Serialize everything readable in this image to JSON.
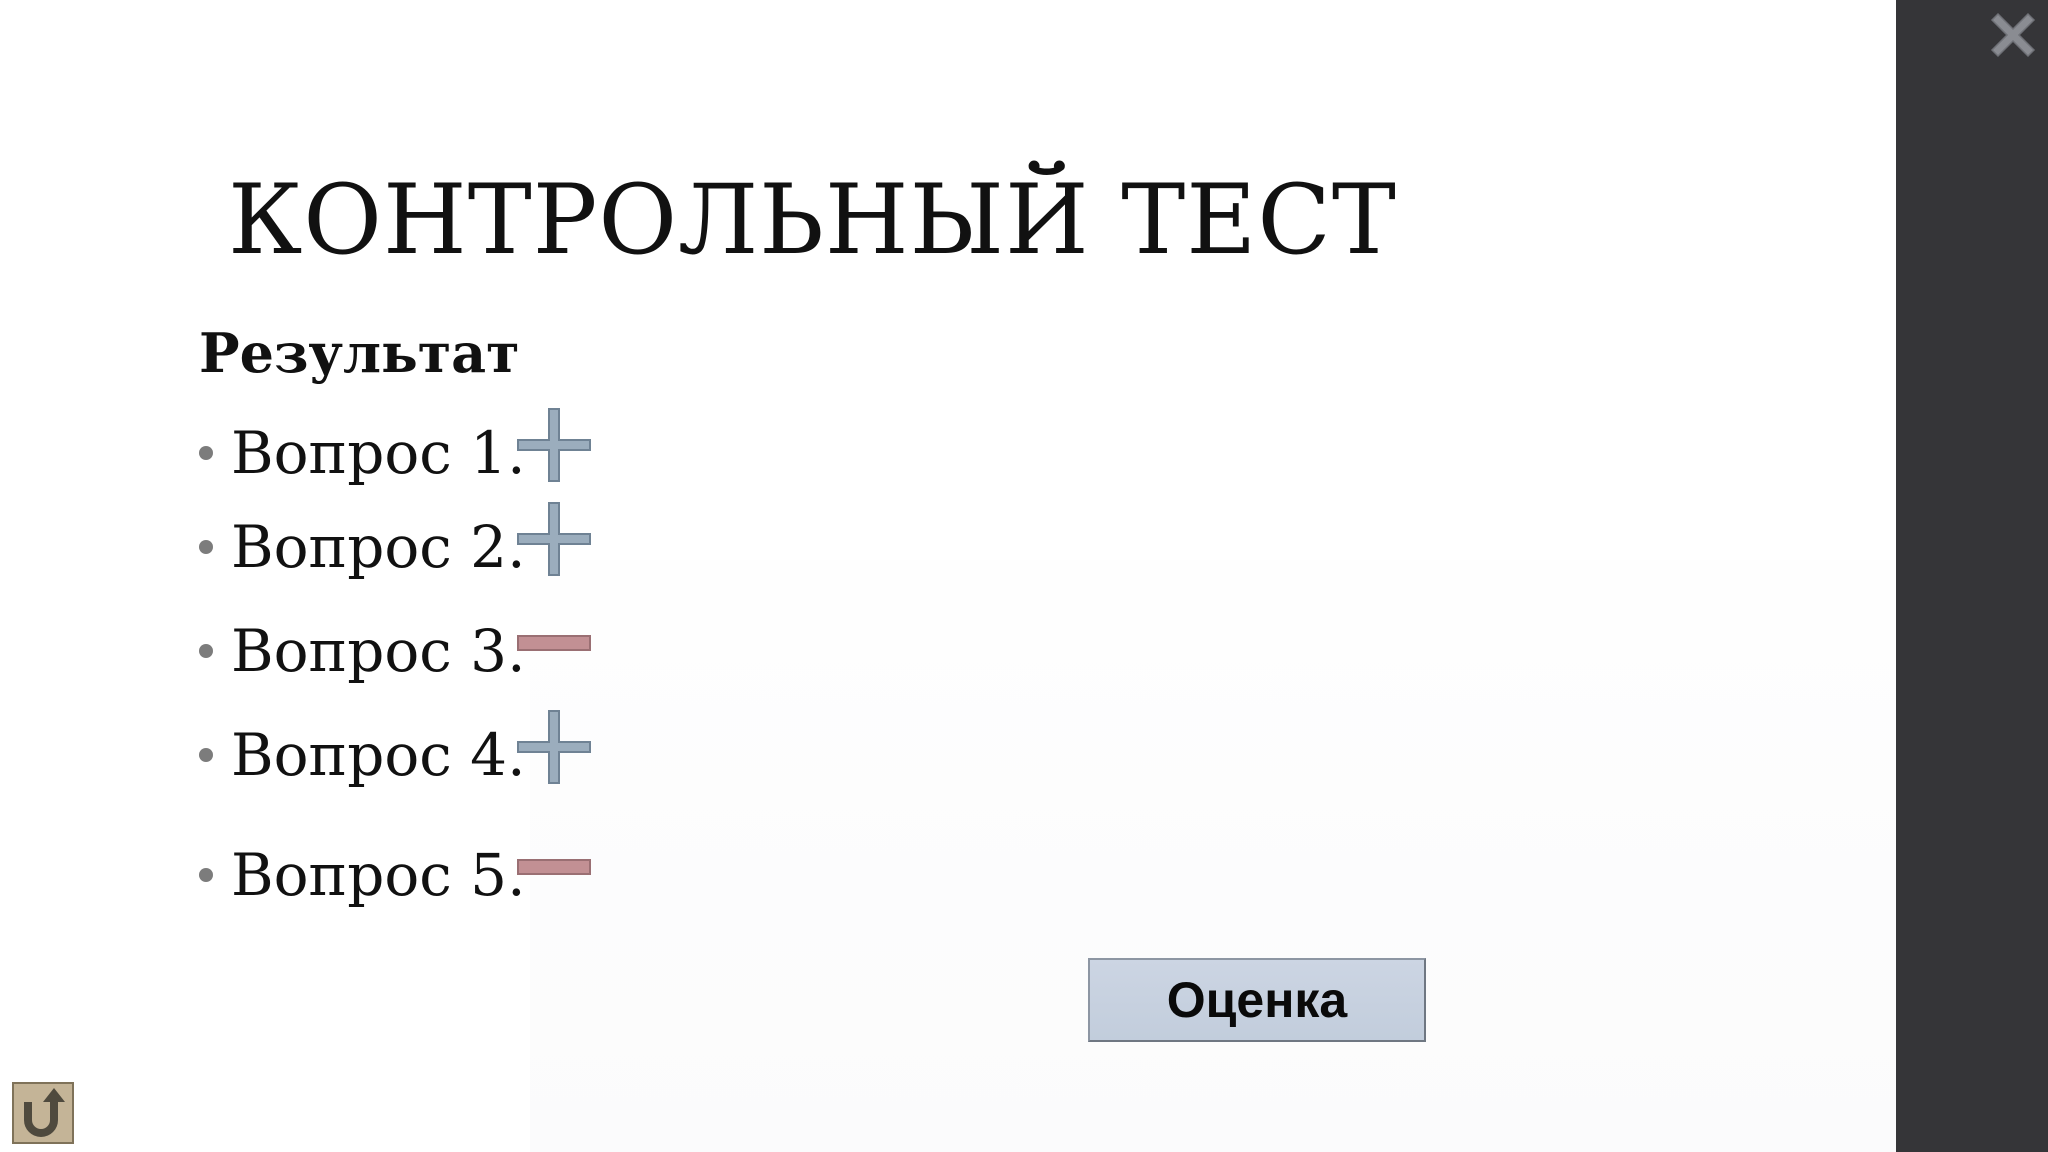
{
  "slide": {
    "title": "КОНТРОЛЬНЫЙ ТЕСТ",
    "subtitle": "Результат",
    "questions": [
      {
        "label": "Вопрос 1.",
        "result": "correct",
        "mark_icon": "plus-icon"
      },
      {
        "label": "Вопрос 2.",
        "result": "correct",
        "mark_icon": "plus-icon"
      },
      {
        "label": "Вопрос 3.",
        "result": "incorrect",
        "mark_icon": "minus-icon"
      },
      {
        "label": "Вопрос 4.",
        "result": "correct",
        "mark_icon": "plus-icon"
      },
      {
        "label": "Вопрос 5.",
        "result": "incorrect",
        "mark_icon": "minus-icon"
      }
    ],
    "evaluate_button_label": "Оценка"
  },
  "controls": {
    "close_icon": "close-icon",
    "back_icon": "undo-arrow-icon"
  },
  "colors": {
    "side_panel": "#353538",
    "plus_fill": "#9badbd",
    "plus_border": "#6f8294",
    "minus_fill": "#c29094",
    "minus_border": "#9a6f73",
    "button_fill": "#c7d1df",
    "back_button_fill": "#c4b497"
  }
}
